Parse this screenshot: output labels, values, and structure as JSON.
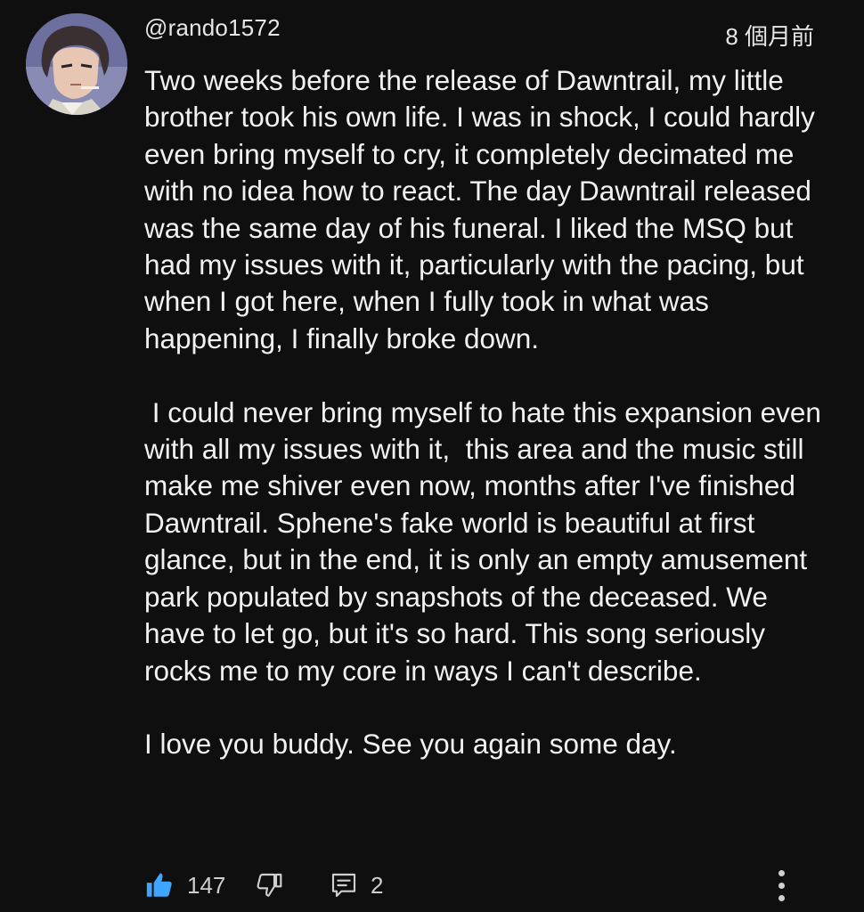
{
  "comment": {
    "author": "@rando1572",
    "timestamp": "8 個月前",
    "paragraphs": [
      "Two weeks before the release of Dawntrail, my little brother took his own life. I was in shock, I could hardly even bring myself to cry, it completely decimated me with no idea how to react. The day Dawntrail released was the same day of his funeral. I liked the MSQ but had my issues with it, particularly with the pacing, but when I got here, when I fully took in what was happening, I finally broke down.",
      " I could never bring myself to hate this expansion even with all my issues with it,  this area and the music still make me shiver even now, months after I've finished Dawntrail. Sphene's fake world is beautiful at first glance, but in the end, it is only an empty amusement park populated by snapshots of the deceased. We have to let go, but it's so hard. This song seriously rocks me to my core in ways I can't describe.",
      "I love you buddy. See you again some day."
    ]
  },
  "actions": {
    "like_count": "147",
    "reply_count": "2",
    "like_icon": "thumbs-up-filled-icon",
    "dislike_icon": "thumbs-down-outline-icon",
    "reply_icon": "reply-comment-icon",
    "more_icon": "more-vertical-icon"
  },
  "colors": {
    "background": "#0f0f0f",
    "text": "#f1f1f1",
    "like_active": "#3ea6ff"
  }
}
